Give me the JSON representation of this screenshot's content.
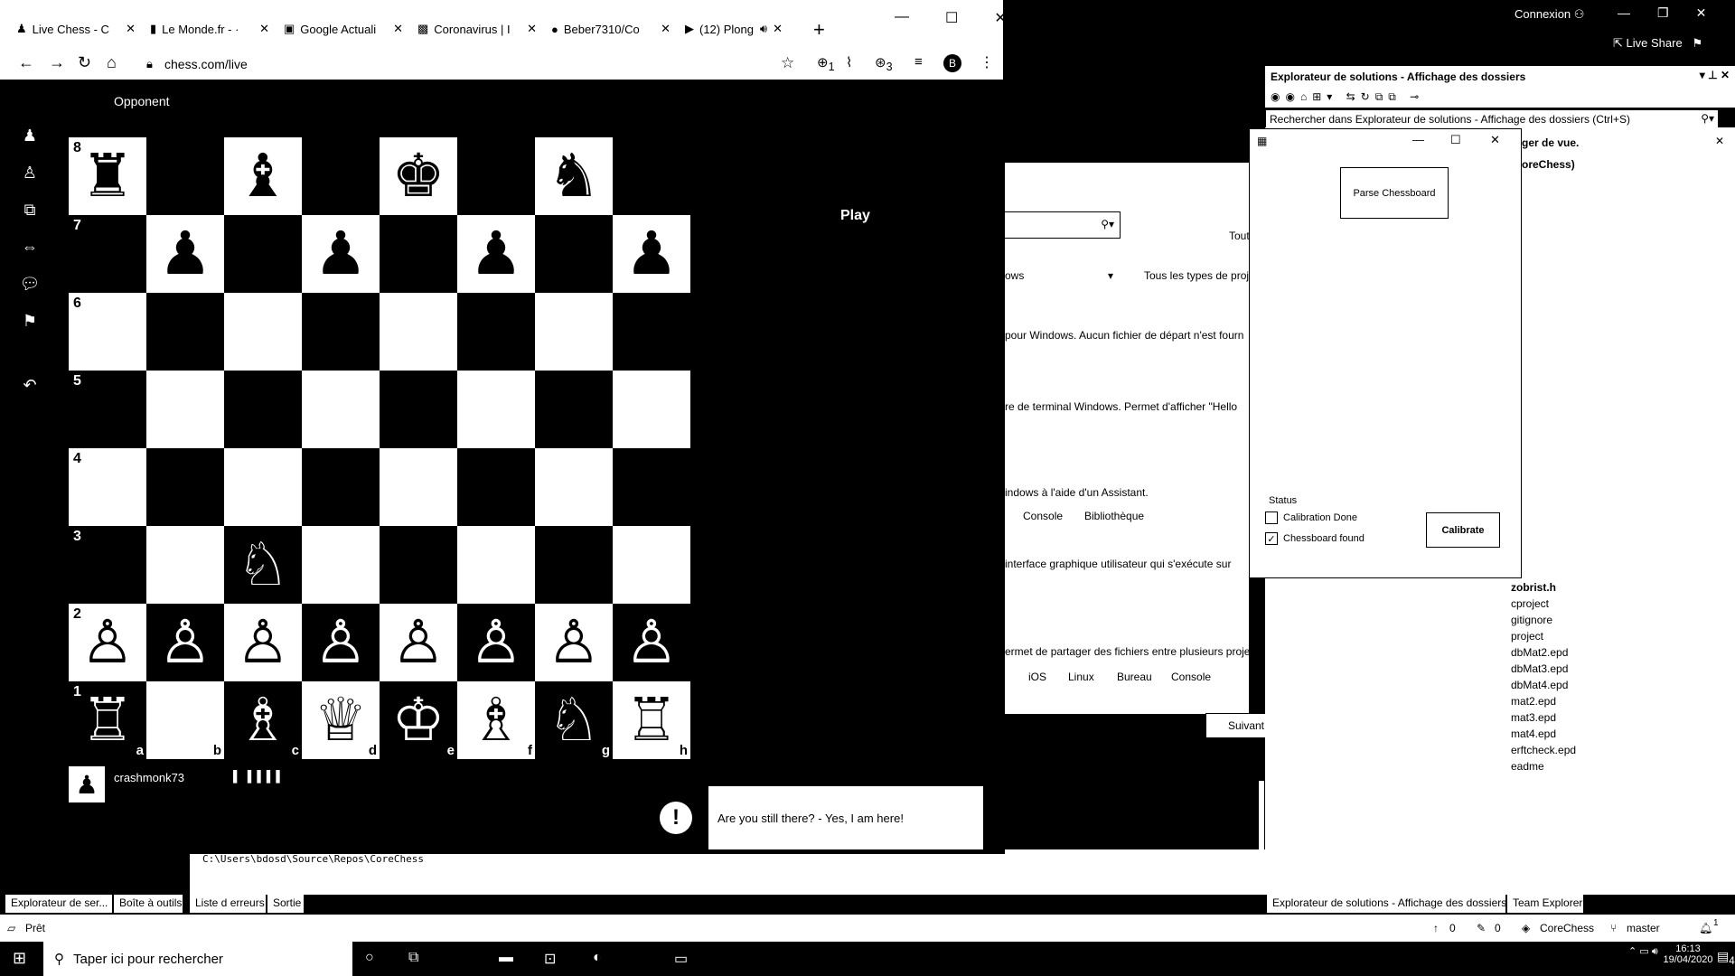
{
  "vs": {
    "connexion": "Connexion",
    "live_share": "Live Share",
    "solution_explorer_title": "Explorateur de solutions - Affichage des dossiers",
    "solution_explorer_search": "Rechercher dans Explorateur de solutions - Affichage des dossiers (Ctrl+S)",
    "partial_view_text": "ger de vue.",
    "partial_project": "oreChess)",
    "middle": {
      "tout": "Tout",
      "ows": "ows",
      "tous_types": "Tous les types de proje",
      "line1": "pour Windows. Aucun fichier de départ n'est fourn",
      "line2": "re de terminal Windows. Permet d'afficher \"Hello",
      "line3": "indows à l'aide d'un Assistant.",
      "tags1": [
        "Console",
        "Bibliothèque"
      ],
      "line4": "interface graphique utilisateur qui s'exécute sur",
      "line5": "ermet de partager des fichiers entre plusieurs projets.",
      "tags2": [
        "iOS",
        "Linux",
        "Bureau",
        "Console"
      ],
      "next_button": "Suivant"
    },
    "files": [
      "zobrist.h",
      "cproject",
      "gitignore",
      "project",
      "dbMat2.epd",
      "dbMat3.epd",
      "dbMat4.epd",
      "mat2.epd",
      "mat3.epd",
      "mat4.epd",
      "erftcheck.epd",
      "eadme"
    ],
    "output_path": "C:\\Users\\bdosd\\Source\\Repos\\CoreChess",
    "bottom_tabs_left": [
      "Explorateur de ser...",
      "Boîte à outils",
      "Liste d erreurs",
      "Sortie"
    ],
    "bottom_tabs_right": [
      "Explorateur de solutions - Affichage des dossiers",
      "Team Explorer"
    ],
    "status": {
      "ready": "Prêt",
      "up_count": "0",
      "edit_count": "0",
      "repo": "CoreChess",
      "branch": "master",
      "notif": "1"
    }
  },
  "chrome": {
    "tabs": [
      {
        "label": "Live Chess - C",
        "icon": "chess-pawn-icon"
      },
      {
        "label": "Le Monde.fr - ·",
        "icon": "lemonde-icon"
      },
      {
        "label": "Google Actuali",
        "icon": "google-news-icon"
      },
      {
        "label": "Coronavirus | I",
        "icon": "dl-icon"
      },
      {
        "label": "Beber7310/Co",
        "icon": "github-icon"
      },
      {
        "label": "(12) Plong",
        "icon": "youtube-icon"
      }
    ],
    "url": "chess.com/live",
    "profile_letter": "B",
    "ext_badge_1": "1",
    "ext_badge_2": "3"
  },
  "chess": {
    "opponent": "Opponent",
    "play": "Play",
    "player_name": "crashmonk73",
    "player_bars": "▌ ▌▌▌▌",
    "alert_text": "Are you still there? - Yes, I am here!",
    "ranks": [
      "8",
      "7",
      "6",
      "5",
      "4",
      "3",
      "2",
      "1"
    ],
    "files": [
      "a",
      "b",
      "c",
      "d",
      "e",
      "f",
      "g",
      "h"
    ],
    "position": [
      [
        "r",
        "",
        "b",
        "",
        "k",
        "",
        "n",
        ""
      ],
      [
        "",
        "p",
        "",
        "p",
        "",
        "p",
        "",
        "p"
      ],
      [
        "",
        "",
        "",
        "",
        "",
        "",
        "",
        ""
      ],
      [
        "",
        "",
        "",
        "",
        "",
        "",
        "",
        ""
      ],
      [
        "",
        "",
        "",
        "",
        "",
        "",
        "",
        ""
      ],
      [
        "",
        "",
        "N",
        "",
        "",
        "",
        "",
        ""
      ],
      [
        "P",
        "P",
        "P",
        "P",
        "P",
        "P",
        "P",
        "P"
      ],
      [
        "R",
        "",
        "B",
        "Q",
        "K",
        "B",
        "N",
        "R"
      ]
    ]
  },
  "app": {
    "parse_button": "Parse Chessboard",
    "status_label": "Status",
    "calibration_done": "Calibration Done",
    "calibration_checked": false,
    "chessboard_found": "Chessboard found",
    "chessboard_checked": true,
    "calibrate_button": "Calibrate"
  },
  "taskbar": {
    "search_placeholder": "Taper ici pour rechercher",
    "time": "16:13",
    "date": "19/04/2020",
    "notif_count": "4"
  }
}
